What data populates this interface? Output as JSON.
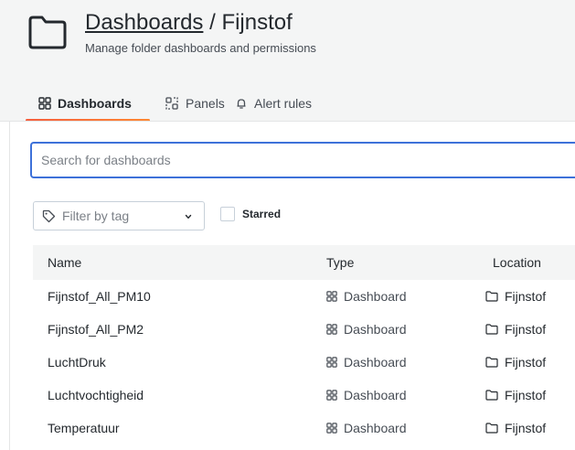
{
  "header": {
    "breadcrumb_parent": "Dashboards",
    "separator": " / ",
    "folder_name": "Fijnstof",
    "subtitle": "Manage folder dashboards and permissions"
  },
  "tabs": [
    {
      "label": "Dashboards",
      "icon": "apps-icon",
      "active": true
    },
    {
      "label": "Panels",
      "icon": "library-panel-icon",
      "active": false
    },
    {
      "label": "Alert rules",
      "icon": "bell-icon",
      "active": false
    }
  ],
  "search": {
    "placeholder": "Search for dashboards",
    "value": ""
  },
  "filter": {
    "placeholder": "Filter by tag"
  },
  "starred": {
    "label": "Starred",
    "checked": false
  },
  "table": {
    "columns": [
      "Name",
      "Type",
      "Location"
    ],
    "rows": [
      {
        "name": "Fijnstof_All_PM10",
        "type": "Dashboard",
        "location": "Fijnstof"
      },
      {
        "name": "Fijnstof_All_PM2",
        "type": "Dashboard",
        "location": "Fijnstof"
      },
      {
        "name": "LuchtDruk",
        "type": "Dashboard",
        "location": "Fijnstof"
      },
      {
        "name": "Luchtvochtigheid",
        "type": "Dashboard",
        "location": "Fijnstof"
      },
      {
        "name": "Temperatuur",
        "type": "Dashboard",
        "location": "Fijnstof"
      }
    ]
  },
  "colors": {
    "accent": "#3d71d9",
    "tab_underline": "#f55f3e"
  }
}
